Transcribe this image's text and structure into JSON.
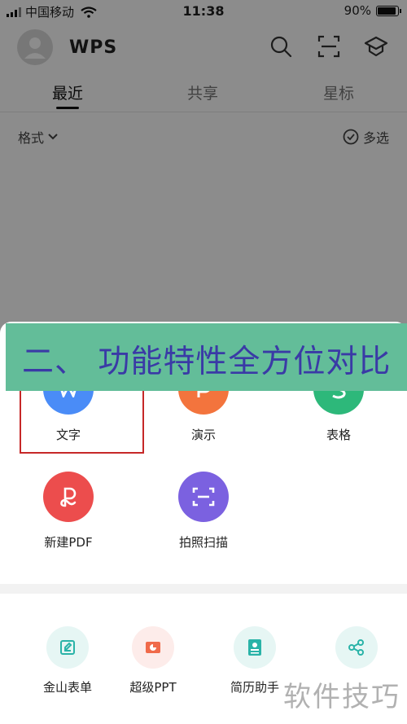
{
  "status_bar": {
    "carrier": "中国移动",
    "time": "11:38",
    "battery": "90%",
    "battery_level": 0.9
  },
  "header": {
    "logo_text": "WPS",
    "icons": [
      "search-icon",
      "scan-icon",
      "graduation-cap-icon"
    ]
  },
  "tabs": [
    {
      "label": "最近",
      "active": true
    },
    {
      "label": "共享",
      "active": false
    },
    {
      "label": "星标",
      "active": false
    }
  ],
  "filter": {
    "format_label": "格式",
    "multi_select_label": "多选"
  },
  "create_items": [
    {
      "label": "文字",
      "color": "#4a8cf7",
      "icon": "w-icon"
    },
    {
      "label": "演示",
      "color": "#f3743d",
      "icon": "p-icon"
    },
    {
      "label": "表格",
      "color": "#2db87a",
      "icon": "s-icon"
    },
    {
      "label": "新建PDF",
      "color": "#ec4d4d",
      "icon": "pdf-icon"
    },
    {
      "label": "拍照扫描",
      "color": "#7b61e0",
      "icon": "camera-scan-icon"
    }
  ],
  "tools": [
    {
      "label": "金山表单",
      "color": "#2ab3a8",
      "bg": "#e6f6f4",
      "icon": "form-icon"
    },
    {
      "label": "超级PPT",
      "color": "#f06a4a",
      "bg": "#fdecea",
      "icon": "ppt-icon"
    },
    {
      "label": "简历助手",
      "color": "#2ab3a8",
      "bg": "#e6f6f4",
      "icon": "resume-icon"
    },
    {
      "label": "",
      "color": "#2ab3a8",
      "bg": "#e6f6f4",
      "icon": "share-icon"
    }
  ],
  "banner": {
    "text": "二、 功能特性全方位对比",
    "bg_color": "#63bd99",
    "text_color": "#3a3aa6"
  },
  "watermark": "软件技巧"
}
